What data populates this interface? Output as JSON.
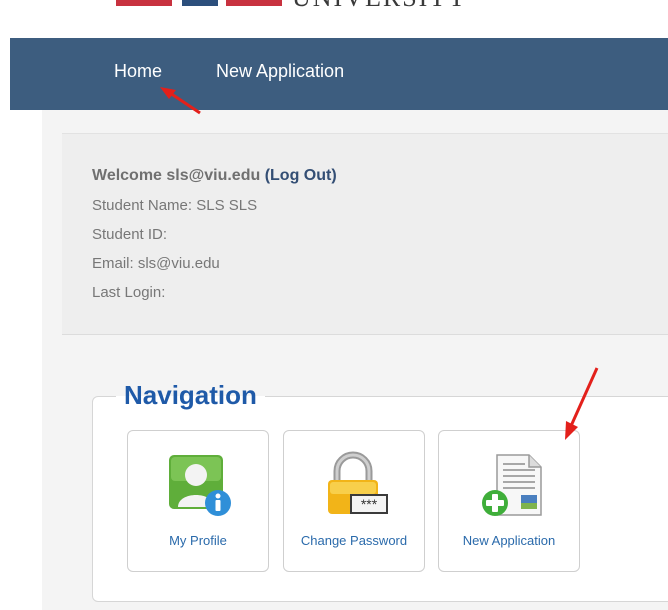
{
  "header": {
    "logo_text": "UNIVERSITY"
  },
  "nav": {
    "home": "Home",
    "new_application": "New Application"
  },
  "welcome": {
    "prefix": "Welcome sls@viu.edu ",
    "logout": "(Log Out)",
    "student_name": "Student Name: SLS SLS",
    "student_id": "Student ID:",
    "email": "Email: sls@viu.edu",
    "last_login": "Last Login:"
  },
  "navigation": {
    "title": "Navigation",
    "tiles": [
      {
        "label": "My Profile",
        "icon": "profile-icon"
      },
      {
        "label": "Change Password",
        "icon": "lock-icon"
      },
      {
        "label": "New Application",
        "icon": "new-document-icon"
      }
    ]
  },
  "colors": {
    "navbar": "#3d5d7f",
    "accent": "#1f5aa8",
    "annotation": "#e3201b"
  }
}
